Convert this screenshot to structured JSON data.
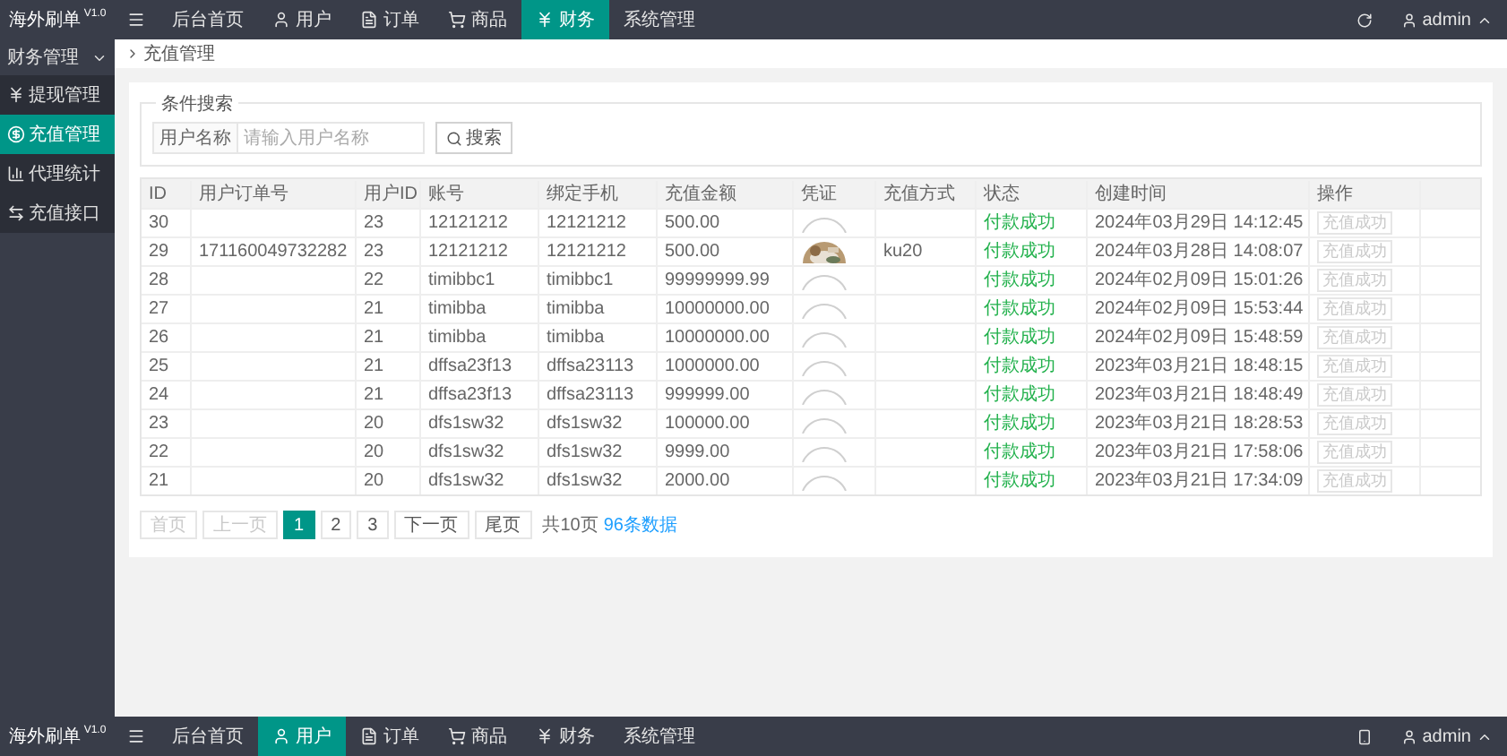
{
  "top_bar": {
    "title": "海外刷单",
    "version": "V1.0",
    "nav": [
      {
        "label": "后台首页",
        "selected": false
      },
      {
        "label": "用户",
        "selected": false
      },
      {
        "label": "订单",
        "selected": false
      },
      {
        "label": "商品",
        "selected": false
      },
      {
        "label": "财务",
        "selected": true
      },
      {
        "label": "系统管理",
        "selected": false
      }
    ],
    "user": "admin"
  },
  "sidebar": {
    "group": {
      "label": "财务管理",
      "expanded": true
    },
    "items": [
      {
        "label": "提现管理",
        "selected": false
      },
      {
        "label": "充值管理",
        "selected": true
      },
      {
        "label": "代理统计",
        "selected": false
      },
      {
        "label": "充值接口",
        "selected": false
      }
    ]
  },
  "breadcrumb": "充值管理",
  "search": {
    "legend": "条件搜索",
    "label": "用户名称",
    "placeholder": "请输入用户名称",
    "button": "搜索"
  },
  "table": {
    "columns": [
      "ID",
      "用户订单号",
      "用户ID",
      "账号",
      "绑定手机",
      "充值金额",
      "凭证",
      "充值方式",
      "状态",
      "创建时间",
      "操作"
    ],
    "rows": [
      {
        "id": "30",
        "order_no": "",
        "user_id": "23",
        "account": "12121212",
        "phone": "12121212",
        "amount": "500.00",
        "voucher": {
          "kind": "empty"
        },
        "method": "",
        "status": "付款成功",
        "created": "2024年03月29日 14:12:45",
        "action": {
          "label": "充值成功",
          "disabled": true
        }
      },
      {
        "id": "29",
        "order_no": "171160049732282",
        "user_id": "23",
        "account": "12121212",
        "phone": "12121212",
        "amount": "500.00",
        "method": "ku20",
        "status": "付款成功",
        "created": "2024年03月28日 14:08:07",
        "action": {
          "label": "充值成功",
          "disabled": true
        }
      },
      {
        "id": "28",
        "order_no": "",
        "user_id": "22",
        "account": "timibbc1",
        "phone": "timibbc1",
        "amount": "99999999.99",
        "voucher": {
          "kind": "empty"
        },
        "method": "",
        "status": "付款成功",
        "created": "2024年02月09日 15:01:26",
        "action": {
          "label": "充值成功",
          "disabled": true
        }
      },
      {
        "id": "27",
        "order_no": "",
        "user_id": "21",
        "account": "timibba",
        "phone": "timibba",
        "amount": "10000000.00",
        "voucher": {
          "kind": "empty"
        },
        "method": "",
        "status": "付款成功",
        "created": "2024年02月09日 15:53:44",
        "action": {
          "label": "充值成功",
          "disabled": true
        }
      },
      {
        "id": "26",
        "order_no": "",
        "user_id": "21",
        "account": "timibba",
        "phone": "timibba",
        "amount": "10000000.00",
        "voucher": {
          "kind": "empty"
        },
        "method": "",
        "status": "付款成功",
        "created": "2024年02月09日 15:48:59",
        "action": {
          "label": "充值成功",
          "disabled": true
        }
      },
      {
        "id": "25",
        "order_no": "",
        "user_id": "21",
        "account": "dffsa23f13",
        "phone": "dffsa23113",
        "amount": "1000000.00",
        "voucher": {
          "kind": "empty"
        },
        "method": "",
        "status": "付款成功",
        "created": "2023年03月21日 18:48:15",
        "action": {
          "label": "充值成功",
          "disabled": true
        }
      },
      {
        "id": "24",
        "order_no": "",
        "user_id": "21",
        "account": "dffsa23f13",
        "phone": "dffsa23113",
        "amount": "999999.00",
        "voucher": {
          "kind": "empty"
        },
        "method": "",
        "status": "付款成功",
        "created": "2023年03月21日 18:48:49",
        "action": {
          "label": "充值成功",
          "disabled": true
        }
      },
      {
        "id": "23",
        "order_no": "",
        "user_id": "20",
        "account": "dfs1sw32",
        "phone": "dfs1sw32",
        "amount": "100000.00",
        "voucher": {
          "kind": "empty"
        },
        "method": "",
        "status": "付款成功",
        "created": "2023年03月21日 18:28:53",
        "action": {
          "label": "充值成功",
          "disabled": true
        }
      },
      {
        "id": "22",
        "order_no": "",
        "user_id": "20",
        "account": "dfs1sw32",
        "phone": "dfs1sw32",
        "amount": "9999.00",
        "voucher": {
          "kind": "empty"
        },
        "method": "",
        "status": "付款成功",
        "created": "2023年03月21日 17:58:06",
        "action": {
          "label": "充值成功",
          "disabled": true
        }
      },
      {
        "id": "21",
        "order_no": "",
        "user_id": "20",
        "account": "dfs1sw32",
        "phone": "dfs1sw32",
        "amount": "2000.00",
        "voucher": {
          "kind": "empty"
        },
        "method": "",
        "status": "付款成功",
        "created": "2023年03月21日 17:34:09",
        "action": {
          "label": "充值成功",
          "disabled": true
        }
      }
    ]
  },
  "pagination": {
    "pages": [
      {
        "label": "首页",
        "selected": false,
        "disabled": true
      },
      {
        "label": "上一页",
        "selected": false,
        "disabled": true
      },
      {
        "label": "1",
        "selected": true,
        "disabled": false
      },
      {
        "label": "2",
        "selected": false,
        "disabled": false
      },
      {
        "label": "3",
        "selected": false,
        "disabled": false
      },
      {
        "label": "下一页",
        "selected": false,
        "disabled": false
      },
      {
        "label": "尾页",
        "selected": false,
        "disabled": false
      }
    ],
    "total_pages": "共10页",
    "total_count": "96条数据"
  },
  "bottom_bar": {
    "title": "海外刷单",
    "version": "V1.0",
    "nav": [
      {
        "label": "后台首页",
        "selected": false
      },
      {
        "label": "用户",
        "selected": true
      },
      {
        "label": "订单",
        "selected": false
      },
      {
        "label": "商品",
        "selected": false
      },
      {
        "label": "财务",
        "selected": false
      },
      {
        "label": "系统管理",
        "selected": false
      }
    ],
    "user": "admin"
  }
}
